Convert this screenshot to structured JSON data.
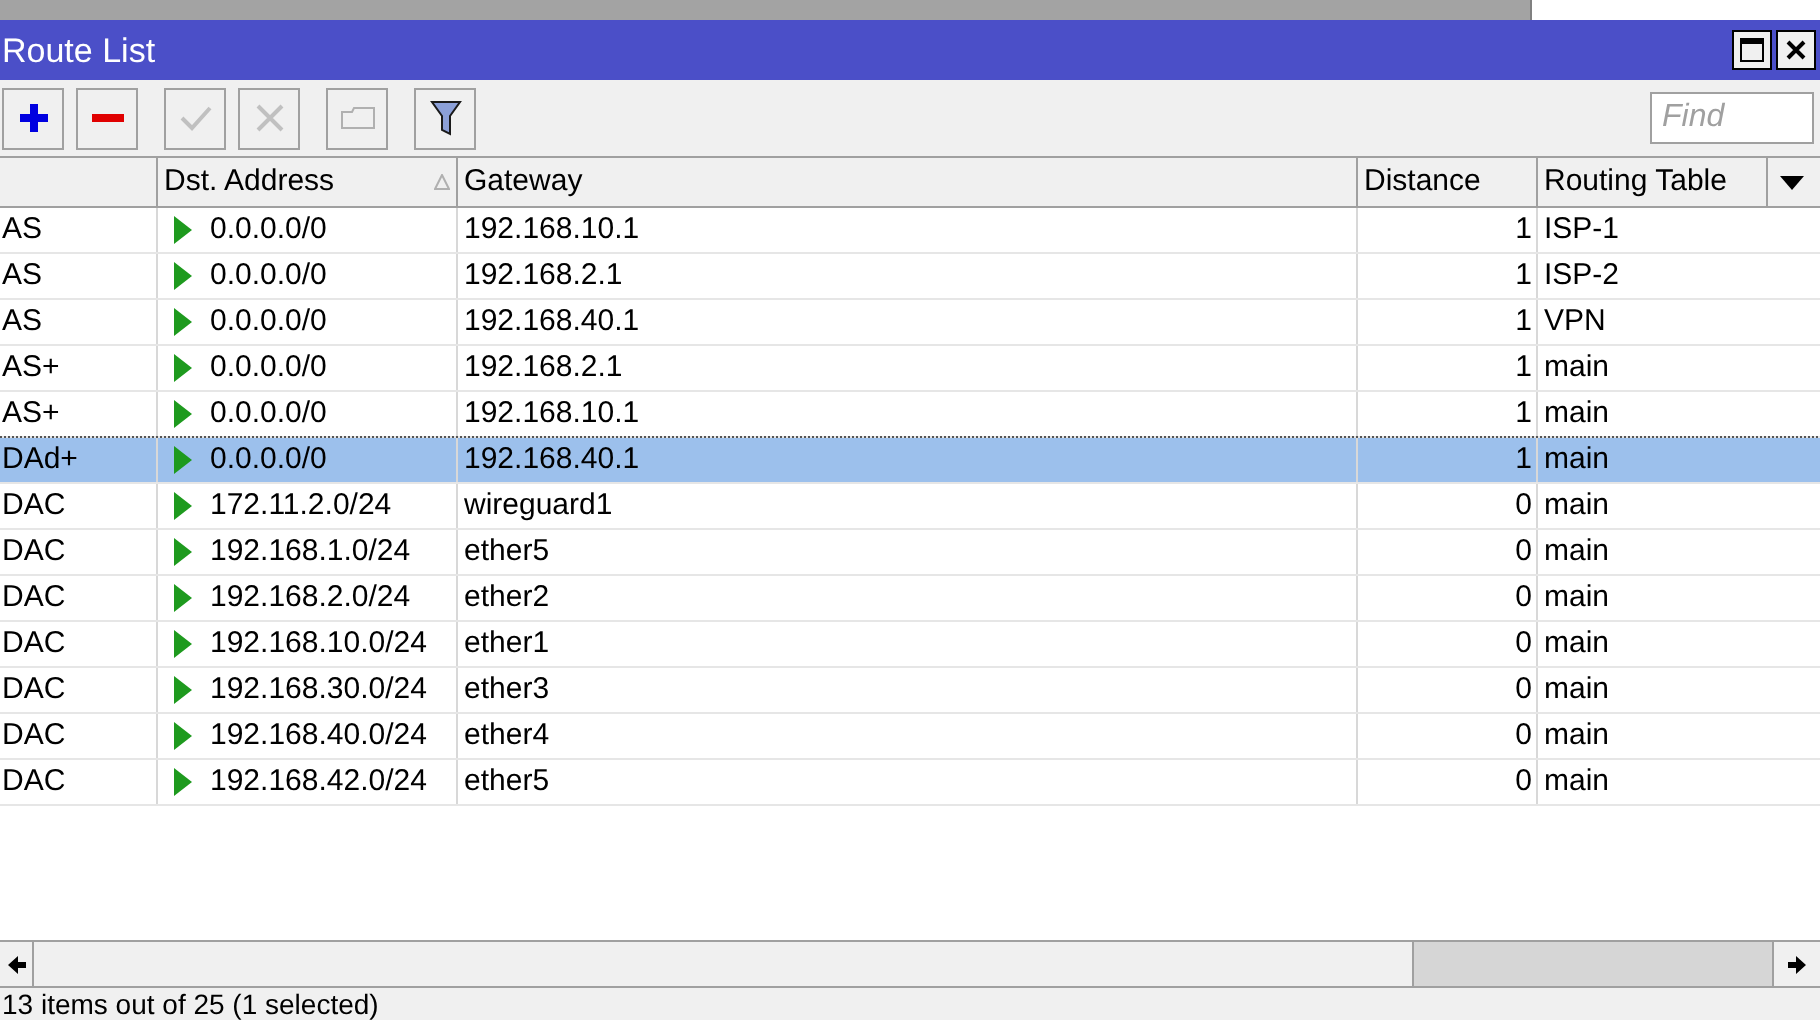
{
  "window": {
    "title": "Route List"
  },
  "toolbar": {
    "find": {
      "placeholder": "Find"
    }
  },
  "table": {
    "columns": [
      "Dst. Address",
      "Gateway",
      "Distance",
      "Routing Table"
    ],
    "rows": [
      {
        "flags": "AS",
        "dst": "0.0.0.0/0",
        "gateway": "192.168.10.1",
        "distance": "1",
        "table": "ISP-1",
        "selected": false
      },
      {
        "flags": "AS",
        "dst": "0.0.0.0/0",
        "gateway": "192.168.2.1",
        "distance": "1",
        "table": "ISP-2",
        "selected": false
      },
      {
        "flags": "AS",
        "dst": "0.0.0.0/0",
        "gateway": "192.168.40.1",
        "distance": "1",
        "table": "VPN",
        "selected": false
      },
      {
        "flags": "AS+",
        "dst": "0.0.0.0/0",
        "gateway": "192.168.2.1",
        "distance": "1",
        "table": "main",
        "selected": false
      },
      {
        "flags": "AS+",
        "dst": "0.0.0.0/0",
        "gateway": "192.168.10.1",
        "distance": "1",
        "table": "main",
        "selected": false
      },
      {
        "flags": "DAd+",
        "dst": "0.0.0.0/0",
        "gateway": "192.168.40.1",
        "distance": "1",
        "table": "main",
        "selected": true
      },
      {
        "flags": "DAC",
        "dst": "172.11.2.0/24",
        "gateway": "wireguard1",
        "distance": "0",
        "table": "main",
        "selected": false
      },
      {
        "flags": "DAC",
        "dst": "192.168.1.0/24",
        "gateway": "ether5",
        "distance": "0",
        "table": "main",
        "selected": false
      },
      {
        "flags": "DAC",
        "dst": "192.168.2.0/24",
        "gateway": "ether2",
        "distance": "0",
        "table": "main",
        "selected": false
      },
      {
        "flags": "DAC",
        "dst": "192.168.10.0/24",
        "gateway": "ether1",
        "distance": "0",
        "table": "main",
        "selected": false
      },
      {
        "flags": "DAC",
        "dst": "192.168.30.0/24",
        "gateway": "ether3",
        "distance": "0",
        "table": "main",
        "selected": false
      },
      {
        "flags": "DAC",
        "dst": "192.168.40.0/24",
        "gateway": "ether4",
        "distance": "0",
        "table": "main",
        "selected": false
      },
      {
        "flags": "DAC",
        "dst": "192.168.42.0/24",
        "gateway": "ether5",
        "distance": "0",
        "table": "main",
        "selected": false
      }
    ]
  },
  "status_bar": "13 items out of 25 (1 selected)"
}
